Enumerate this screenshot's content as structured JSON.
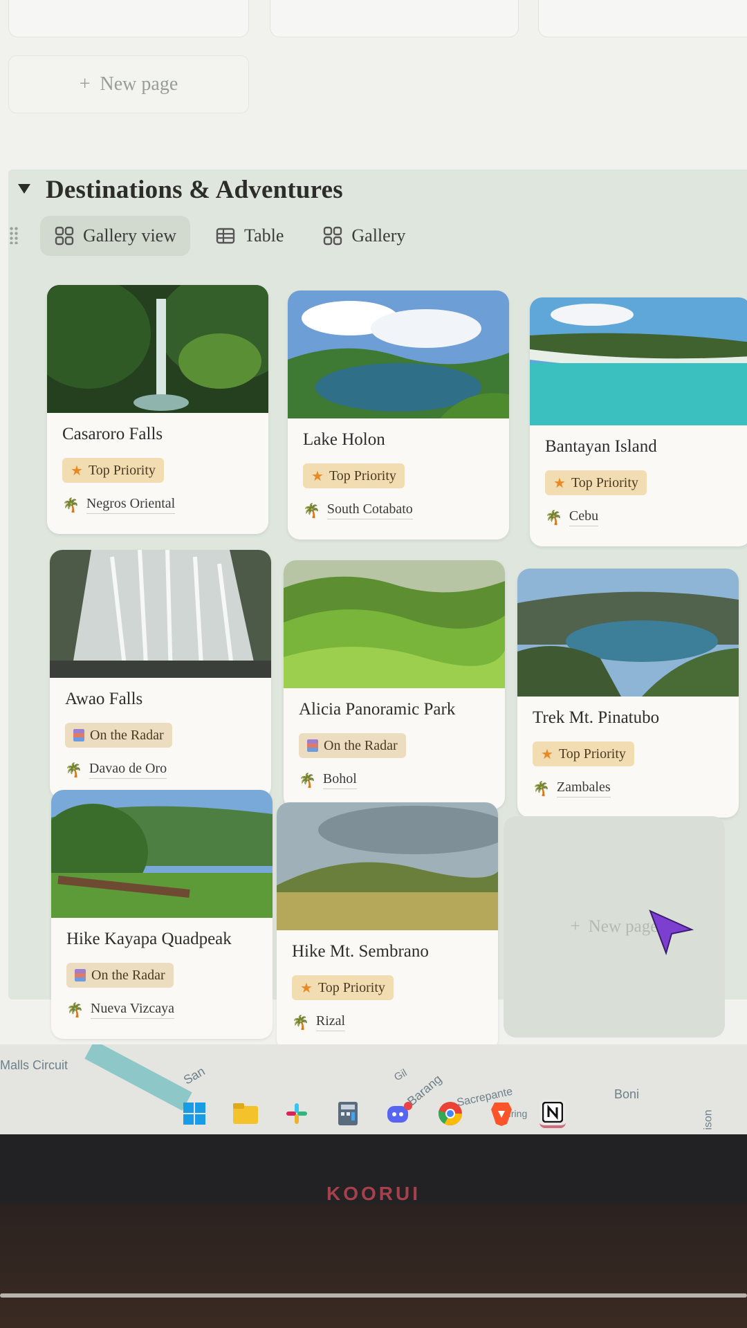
{
  "top": {
    "new_page_label": "New page"
  },
  "section": {
    "title": "Destinations & Adventures",
    "tabs": [
      {
        "label": "Gallery view",
        "icon": "gallery-icon",
        "active": true
      },
      {
        "label": "Table",
        "icon": "table-icon",
        "active": false
      },
      {
        "label": "Gallery",
        "icon": "gallery-icon",
        "active": false
      }
    ]
  },
  "cards": [
    {
      "title": "Casaroro Falls",
      "tag": "Top Priority",
      "tag_type": "top",
      "location": "Negros Oriental",
      "cover": "waterfall"
    },
    {
      "title": "Lake Holon",
      "tag": "Top Priority",
      "tag_type": "top",
      "location": "South Cotabato",
      "cover": "crater-lake"
    },
    {
      "title": "Bantayan Island",
      "tag": "Top Priority",
      "tag_type": "top",
      "location": "Cebu",
      "cover": "island"
    },
    {
      "title": "Awao Falls",
      "tag": "On the Radar",
      "tag_type": "radar",
      "location": "Davao de Oro",
      "cover": "cascade"
    },
    {
      "title": "Alicia Panoramic Park",
      "tag": "On the Radar",
      "tag_type": "radar",
      "location": "Bohol",
      "cover": "green-hills"
    },
    {
      "title": "Trek Mt. Pinatubo",
      "tag": "Top Priority",
      "tag_type": "top",
      "location": "Zambales",
      "cover": "volcano-lake"
    },
    {
      "title": "Hike Kayapa Quadpeak",
      "tag": "On the Radar",
      "tag_type": "radar",
      "location": "Nueva Vizcaya",
      "cover": "mountain-forest"
    },
    {
      "title": "Hike Mt. Sembrano",
      "tag": "Top Priority",
      "tag_type": "top",
      "location": "Rizal",
      "cover": "grassland"
    }
  ],
  "gallery_new_page_label": "New page",
  "map": {
    "labels": [
      "Malls Circuit",
      "San",
      "Gil",
      "Barang",
      "Sacrepante",
      "Iring",
      "Boni",
      "ison"
    ]
  },
  "taskbar": {
    "icons": [
      "windows-start-icon",
      "file-explorer-icon",
      "slack-icon",
      "calculator-icon",
      "discord-icon",
      "chrome-icon",
      "brave-icon",
      "notion-icon"
    ]
  },
  "monitor": {
    "brand": "KOORUI"
  },
  "colors": {
    "section_bg": "#dfe6dd",
    "tag_top": "#f2dcb2",
    "tag_radar": "#ecdcc0",
    "accent_palm": "#3d8b3d"
  }
}
